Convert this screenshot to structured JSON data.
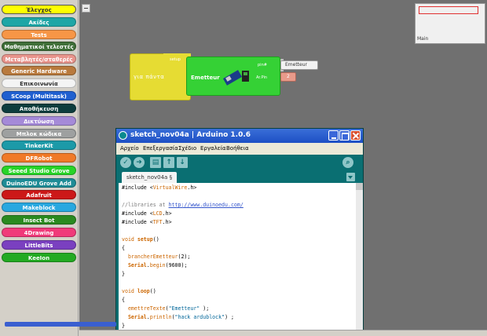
{
  "palette": {
    "categories": [
      {
        "label": "Έλεγχος",
        "color": "#ffff00",
        "text_dark": true,
        "selected": true
      },
      {
        "label": "Ακίδες",
        "color": "#1ea6a6"
      },
      {
        "label": "Tests",
        "color": "#f79646"
      },
      {
        "label": "Μαθηματικοί τελεστές",
        "color": "#3f6f38"
      },
      {
        "label": "Μεταβλητές/σταθερές",
        "color": "#e8948c"
      },
      {
        "label": "Generic Hardware",
        "color": "#b97a3d"
      },
      {
        "label": "Επικοινωνία",
        "color": "#f4f4f4",
        "text_dark": true
      },
      {
        "label": "SCoop (Multitask)",
        "color": "#2060d0"
      },
      {
        "label": "Αποθήκευση",
        "color": "#0d3d3d"
      },
      {
        "label": "Δικτύωση",
        "color": "#a58ad8"
      },
      {
        "label": "Μπλοκ κώδικα",
        "color": "#9ea0a0"
      },
      {
        "label": "TinkerKit",
        "color": "#1c9aa8"
      },
      {
        "label": "DFRobot",
        "color": "#f07a28"
      },
      {
        "label": "Seeed Studio Grove",
        "color": "#28d428"
      },
      {
        "label": "DuinoEDU Grove Add",
        "color": "#1e8c96"
      },
      {
        "label": "Adafruit",
        "color": "#cc1818"
      },
      {
        "label": "Makeblock",
        "color": "#28a8e0"
      },
      {
        "label": "Insect Bot",
        "color": "#2a8a20"
      },
      {
        "label": "4Drawing",
        "color": "#f03a7a"
      },
      {
        "label": "LittleBits",
        "color": "#7a40c0"
      },
      {
        "label": "KeeIon",
        "color": "#22aa22"
      }
    ]
  },
  "workspace": {
    "minimap_label": "Main",
    "loop_block": {
      "label": "για πάντα",
      "small_text": "setup"
    },
    "emit_block": {
      "label": "Emetteur",
      "param1": "pin#",
      "param2": "Ar.Pin"
    },
    "string_block": {
      "value": "Emetteur"
    },
    "number_block": {
      "value": "2"
    }
  },
  "ide": {
    "title": "sketch_nov04a | Arduino 1.0.6",
    "menu": [
      "Αρχείο",
      "Επεξεργασία",
      "Σχέδιο",
      "Εργαλεία",
      "Βοήθεια"
    ],
    "tab_label": "sketch_nov04a §",
    "code": {
      "l1_a": "#include <",
      "l1_b": "VirtualWire",
      "l1_c": ".h>",
      "l2_a": "//libraries at ",
      "l2_b": "http://www.duinoedu.com/",
      "l3_a": "#include <",
      "l3_b": "LCD",
      "l3_c": ".h>",
      "l4_a": "#include <",
      "l4_b": "TFT",
      "l4_c": ".h>",
      "l5_a": "void ",
      "l5_b": "setup",
      "l5_c": "()",
      "l6": "{",
      "l7_a": "  ",
      "l7_b": "brancherEmetteur",
      "l7_c": "(2);",
      "l8_a": "  ",
      "l8_b": "Serial",
      "l8_c": ".",
      "l8_d": "begin",
      "l8_e": "(9600);",
      "l9": "}",
      "l10_a": "void ",
      "l10_b": "loop",
      "l10_c": "()",
      "l11": "{",
      "l12_a": "  ",
      "l12_b": "emettreTexte",
      "l12_c": "(",
      "l12_d": "\"Emetteur\"",
      "l12_e": " );",
      "l13_a": "  ",
      "l13_b": "Serial",
      "l13_c": ".",
      "l13_d": "println",
      "l13_e": "(",
      "l13_f": "\"hack ardublock\"",
      "l13_g": ") ;",
      "l14": "}"
    }
  }
}
